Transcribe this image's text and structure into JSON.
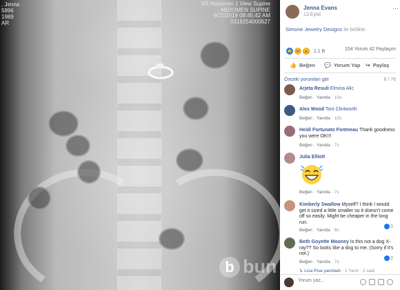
{
  "photo": {
    "xray_left_text": ", Jenna\n5896\n1989\nAR",
    "xray_right_lines": [
      "XR Abdomen 1 View Supine",
      "ABDOMEN SUPINE",
      "9/11/2019 08:45:42 AM",
      "0319254000627"
    ],
    "watermark_letter": "b",
    "watermark_text": "bun"
  },
  "post": {
    "author": "Jenna Evans",
    "date": "13 Eylül",
    "more": "···",
    "with_link": "Simone Jewelry Designs",
    "with_suffix": "ile birlikte."
  },
  "reactions": {
    "count": "1,1 B",
    "comments": "154 Yorum",
    "shares": "42 Paylaşım",
    "icons": [
      "like-icon",
      "haha-icon",
      "wow-icon"
    ]
  },
  "actions": {
    "like": "Beğen",
    "comment": "Yorum Yap",
    "share": "Paylaş"
  },
  "comments_header": {
    "previous": "Önceki yorumları gör",
    "count": "6 / 76"
  },
  "comments": [
    {
      "name": "Arjeta Resuli",
      "tag": "Elmina Alic",
      "text": "",
      "like": "Beğen",
      "reply": "Yanıtla",
      "time": "10s"
    },
    {
      "name": "Alex Wood",
      "tag": "Toni Clintworth",
      "text": "",
      "like": "Beğen",
      "reply": "Yanıtla",
      "time": "10s"
    },
    {
      "name": "Heidi Fortunato Fontneau",
      "tag": "",
      "text": "Thank goodness you were OK!!!",
      "like": "Beğen",
      "reply": "Yanıtla",
      "time": "7s"
    },
    {
      "name": "Julia Elliott",
      "tag": "",
      "text": "",
      "like": "Beğen",
      "reply": "Yanıtla",
      "time": "7s"
    },
    {
      "name": "Kimberly Swallow",
      "tag": "",
      "text": "Myself? I think I would get it sized a little smaller so it doesn't come off so easily. Might be cheaper in the long run.",
      "like": "Beğen",
      "reply": "Yanıtla",
      "time": "6s",
      "badge": "1"
    },
    {
      "name": "Beth Goyette Mooney",
      "tag": "",
      "text": "Is this not a dog X-ray?? So looks like a dog to me. (Sorry if it's not.)",
      "like": "Beğen",
      "reply": "Yanıtla",
      "time": "7s",
      "badge": "2"
    }
  ],
  "reply_line": {
    "name": "Lisa Pisa yanıtladı",
    "count": "1 Yanıt",
    "time": "2 saat"
  },
  "composer": {
    "placeholder": "Yorum yaz..."
  },
  "colors": {
    "link": "#385898",
    "muted": "#90949c",
    "like_blue": "#1877f2"
  }
}
